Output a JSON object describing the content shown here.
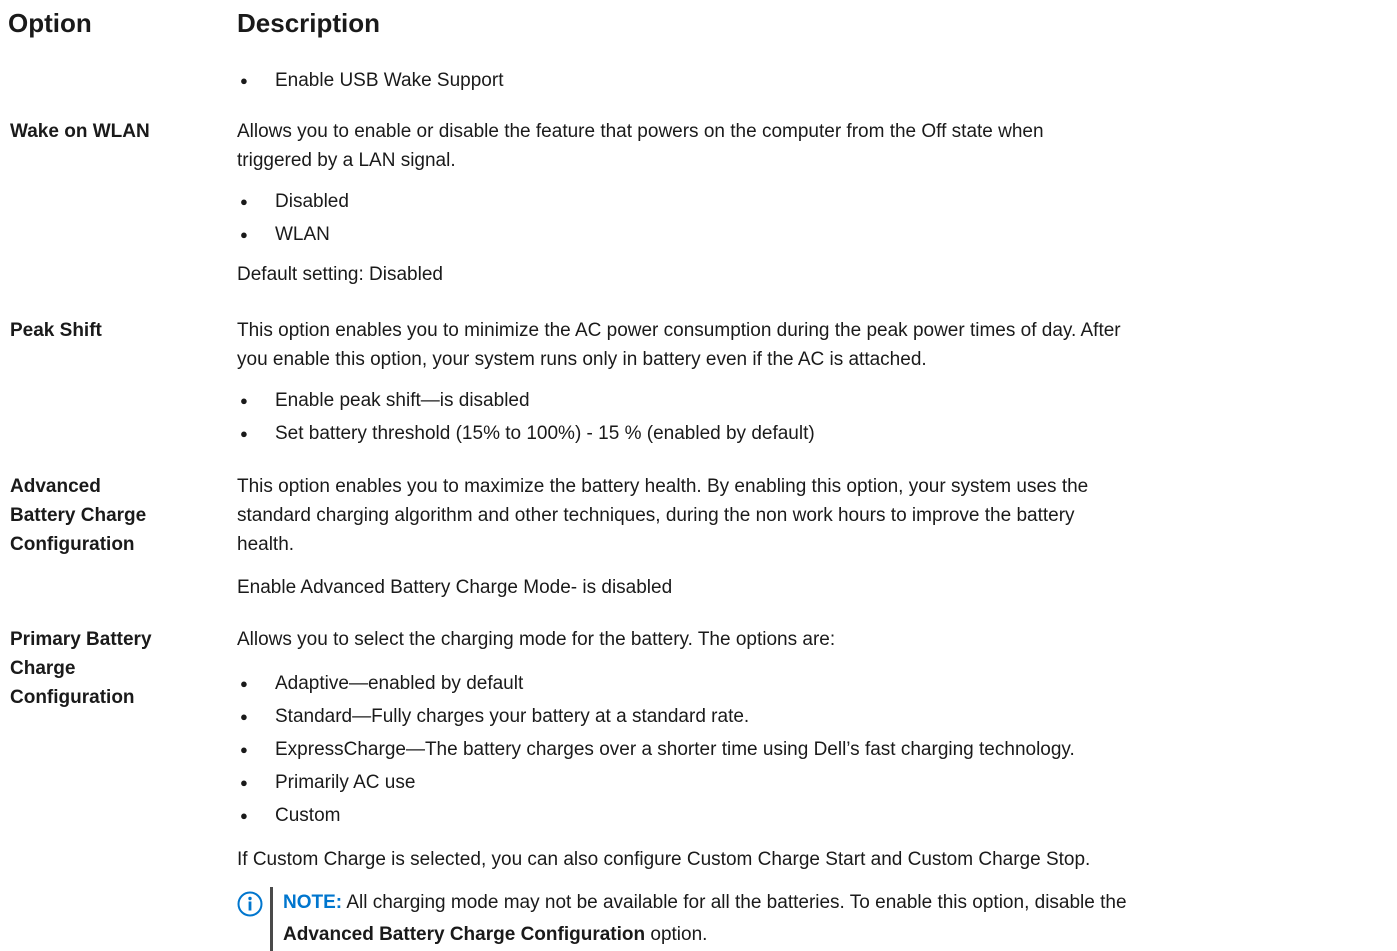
{
  "header": {
    "option": "Option",
    "description": "Description"
  },
  "wake_usb": {
    "bullet": "Enable USB Wake Support"
  },
  "wake_wlan": {
    "name": "Wake on WLAN",
    "desc_line1": "Allows you to enable or disable the feature that powers on the computer from the Off state when",
    "desc_line2": "triggered by a LAN signal.",
    "options": [
      "Disabled",
      "WLAN"
    ],
    "default": "Default setting: Disabled"
  },
  "peak_shift": {
    "name": "Peak Shift",
    "desc_line1": "This option enables you to minimize the AC power consumption during the peak power times of day. After",
    "desc_line2": "you enable this option, your system runs only in battery even if the AC is attached.",
    "options": [
      "Enable peak shift—is disabled",
      "Set battery threshold (15% to 100%) - 15 % (enabled by default)"
    ]
  },
  "advanced_battery": {
    "name_line1": "Advanced",
    "name_line2": "Battery Charge",
    "name_line3": "Configuration",
    "desc_line1": "This option enables you to maximize the battery health. By enabling this option, your system uses the",
    "desc_line2": "standard charging algorithm and other techniques, during the non work hours to improve the battery",
    "desc_line3": "health.",
    "status": "Enable Advanced Battery Charge Mode- is disabled"
  },
  "primary_battery": {
    "name_line1": "Primary Battery",
    "name_line2": "Charge",
    "name_line3": "Configuration",
    "desc": "Allows you to select the charging mode for the battery. The options are:",
    "options": [
      "Adaptive—enabled by default",
      "Standard—Fully charges your battery at a standard rate.",
      "ExpressCharge—The battery charges over a shorter time using Dell’s fast charging technology.",
      "Primarily AC use",
      "Custom"
    ],
    "custom_note": "If Custom Charge is selected, you can also configure Custom Charge Start and Custom Charge Stop.",
    "note_label": "NOTE:",
    "note_text1": " All charging mode may not be available for all the batteries. To enable this option, disable the",
    "note_bold": "Advanced Battery Charge Configuration",
    "note_text2": " option."
  }
}
